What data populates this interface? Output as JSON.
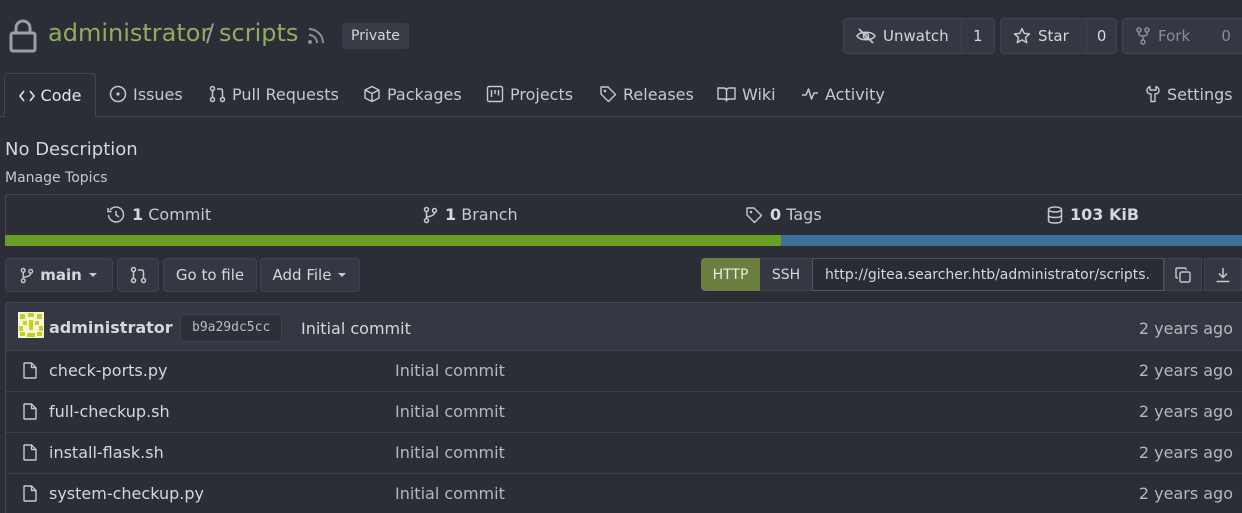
{
  "header": {
    "owner": "administrator",
    "separator": "/",
    "repo": "scripts",
    "visibility_badge": "Private",
    "unwatch": {
      "label": "Unwatch",
      "count": "1"
    },
    "star": {
      "label": "Star",
      "count": "0"
    },
    "fork": {
      "label": "Fork",
      "count": "0"
    }
  },
  "tabs": [
    {
      "label": "Code",
      "icon": "code-icon"
    },
    {
      "label": "Issues",
      "icon": "issue-icon"
    },
    {
      "label": "Pull Requests",
      "icon": "pull-request-icon"
    },
    {
      "label": "Packages",
      "icon": "package-icon"
    },
    {
      "label": "Projects",
      "icon": "project-icon"
    },
    {
      "label": "Releases",
      "icon": "tag-icon"
    },
    {
      "label": "Wiki",
      "icon": "book-icon"
    },
    {
      "label": "Activity",
      "icon": "pulse-icon"
    },
    {
      "label": "Settings",
      "icon": "tool-icon"
    }
  ],
  "repo": {
    "description": "No Description",
    "manage_topics": "Manage Topics"
  },
  "stats": {
    "commits": {
      "count": "1",
      "label": "Commit"
    },
    "branches": {
      "count": "1",
      "label": "Branch"
    },
    "tags": {
      "count": "0",
      "label": "Tags"
    },
    "size": "103 KiB"
  },
  "language_bar": [
    {
      "fraction": 0.626,
      "color": "#6b9e24"
    },
    {
      "fraction": 0.374,
      "color": "#3d6f99"
    }
  ],
  "toolbar": {
    "branch": "main",
    "go_to_file": "Go to file",
    "add_file": "Add File",
    "http": "HTTP",
    "ssh": "SSH",
    "clone_url": "http://gitea.searcher.htb/administrator/scripts.git"
  },
  "latest_commit": {
    "author": "administrator",
    "sha": "b9a29dc5cc",
    "message": "Initial commit",
    "time": "2 years ago"
  },
  "files": [
    {
      "name": "check-ports.py",
      "message": "Initial commit",
      "time": "2 years ago"
    },
    {
      "name": "full-checkup.sh",
      "message": "Initial commit",
      "time": "2 years ago"
    },
    {
      "name": "install-flask.sh",
      "message": "Initial commit",
      "time": "2 years ago"
    },
    {
      "name": "system-checkup.py",
      "message": "Initial commit",
      "time": "2 years ago"
    }
  ],
  "colors": {
    "background": "#2b2d37",
    "accent_green": "#90ad5e",
    "http_active": "#6b8040"
  }
}
